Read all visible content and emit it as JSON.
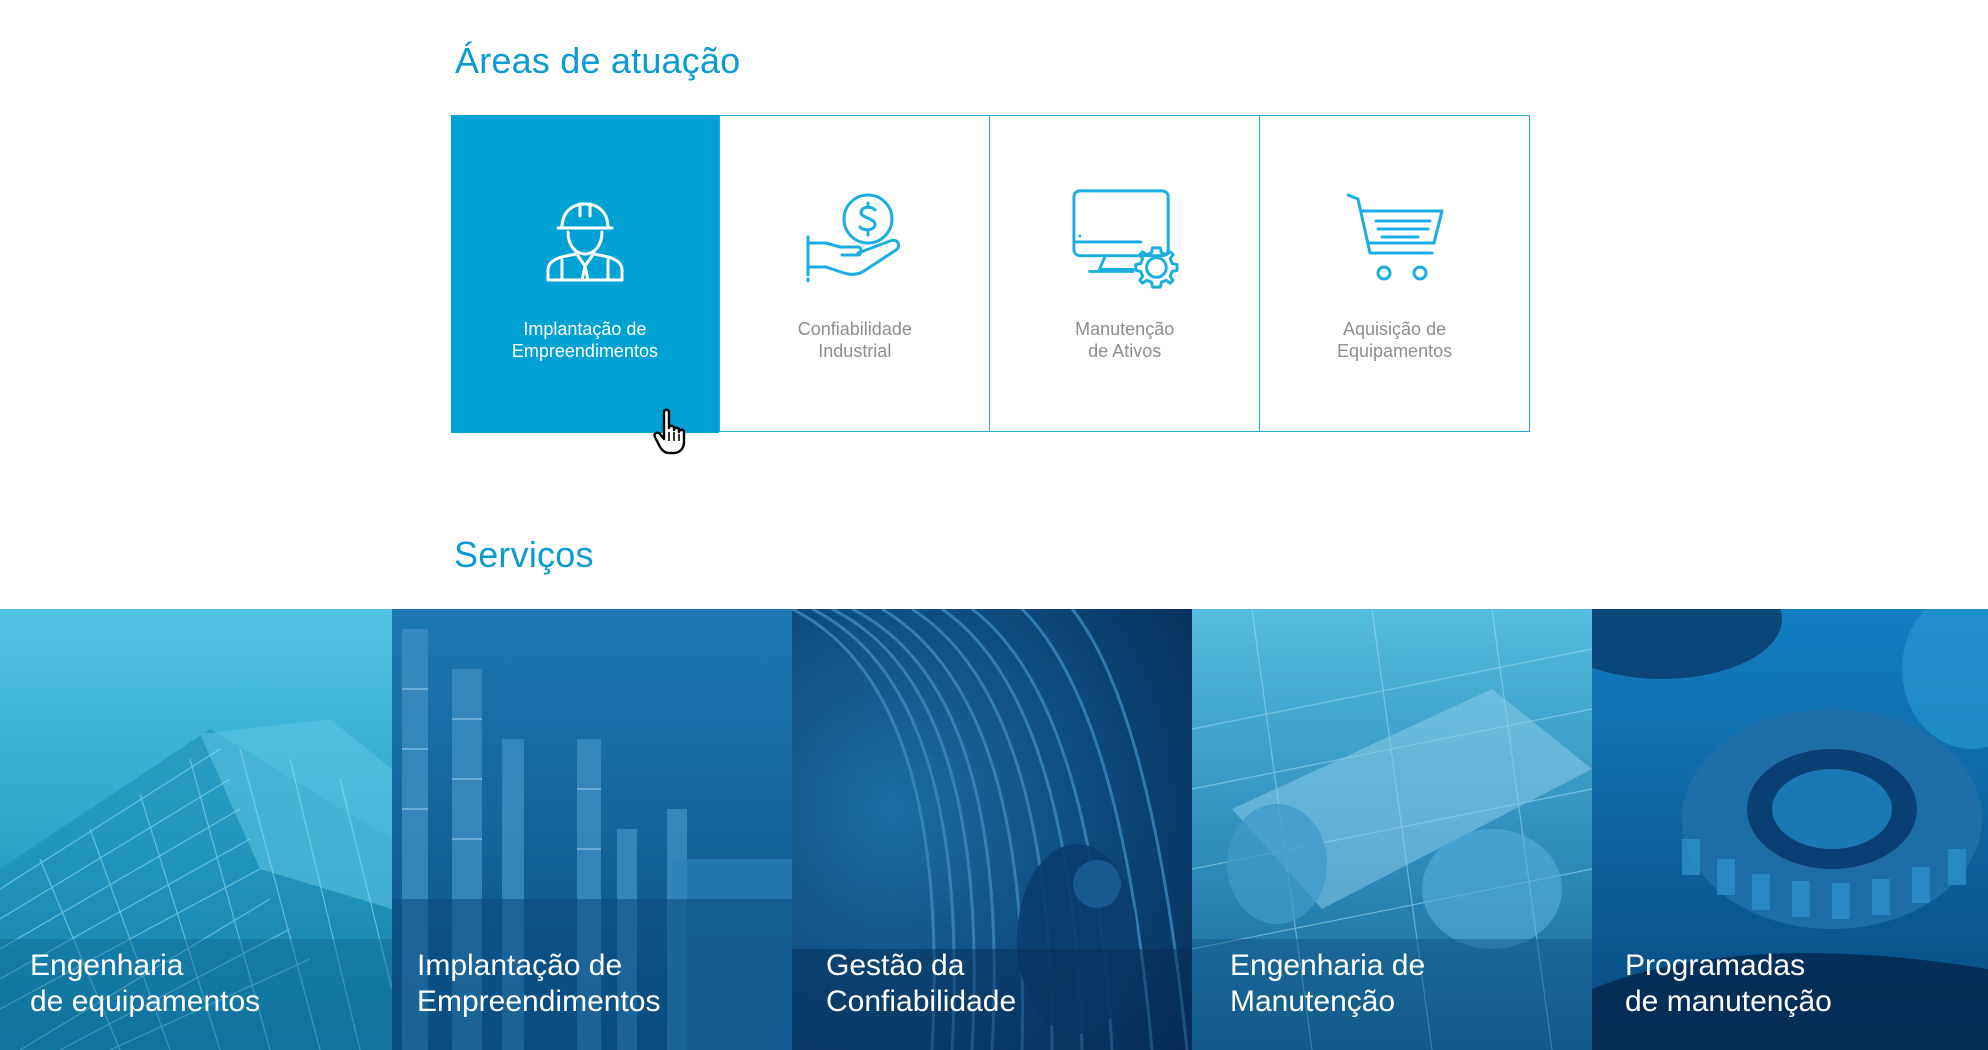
{
  "areas": {
    "title": "Áreas de atuação",
    "items": [
      {
        "line1": "Implantação de",
        "line2": "Empreendimentos",
        "icon": "engineer-icon",
        "active": true
      },
      {
        "line1": "Confiabilidade",
        "line2": "Industrial",
        "icon": "money-hand-icon",
        "active": false
      },
      {
        "line1": "Manutenção",
        "line2": "de Ativos",
        "icon": "monitor-gear-icon",
        "active": false
      },
      {
        "line1": "Aquisição de",
        "line2": "Equipamentos",
        "icon": "shopping-cart-icon",
        "active": false
      }
    ]
  },
  "services": {
    "title": "Serviços",
    "items": [
      {
        "line1": "Engenharia",
        "line2": "de equipamentos",
        "image": "glass-building"
      },
      {
        "line1": "Implantação de",
        "line2": "Empreendimentos",
        "image": "refinery"
      },
      {
        "line1": "Gestão da",
        "line2": "Confiabilidade",
        "image": "turbine-technician"
      },
      {
        "line1": "Engenharia de",
        "line2": "Manutenção",
        "image": "blueprints"
      },
      {
        "line1": "Programadas",
        "line2": "de manutenção",
        "image": "gears"
      }
    ]
  },
  "colors": {
    "accent": "#00a2d3",
    "title": "#0a9bd1",
    "label_gray": "#8d8d8d"
  }
}
